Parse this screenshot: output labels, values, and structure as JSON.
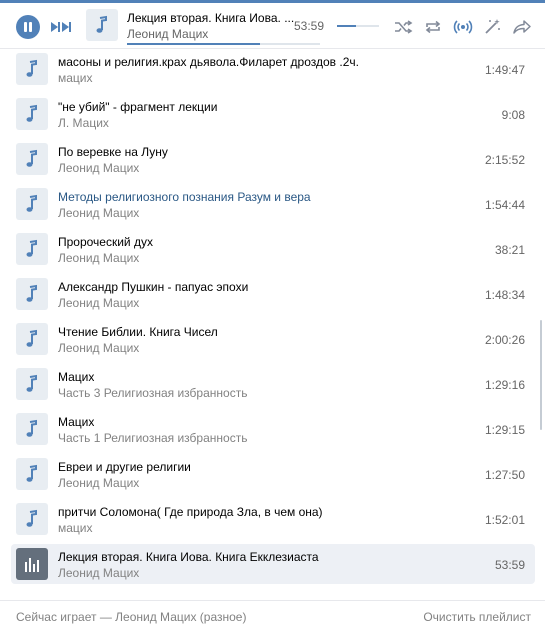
{
  "player": {
    "title": "Лекция вторая. Книга Иова. ...",
    "artist": "Леонид Мацих",
    "time": "53:59",
    "progress": 0.69,
    "volume": 0.45,
    "icons": [
      "pause-icon",
      "next-icon",
      "music-note-icon",
      "shuffle-icon",
      "repeat-icon",
      "broadcast-icon",
      "recommendations-icon",
      "share-icon"
    ]
  },
  "tracks": [
    {
      "title": "масоны и религия.крах дьявола.Филарет дроздов .2ч.",
      "artist": "мацих",
      "duration": "1:49:47"
    },
    {
      "title": "\"не убий\" - фрагмент лекции",
      "artist": "Л. Мацих",
      "duration": "9:08"
    },
    {
      "title": "По веревке на Луну",
      "artist": "Леонид Мацих",
      "duration": "2:15:52"
    },
    {
      "title": "Методы религиозного познания Разум и вера",
      "artist": "Леонид Мацих",
      "duration": "1:54:44"
    },
    {
      "title": "Пророческий дух",
      "artist": "Леонид Мацих",
      "duration": "38:21"
    },
    {
      "title": "Александр Пушкин - папуас эпохи",
      "artist": "Леонид Мацих",
      "duration": "1:48:34"
    },
    {
      "title": "Чтение Библии. Книга Чисел",
      "artist": "Леонид Мацих",
      "duration": "2:00:26"
    },
    {
      "title": "Мацих",
      "artist": "Часть 3 Религиозная избранность",
      "duration": "1:29:16"
    },
    {
      "title": "Мацих",
      "artist": "Часть 1 Религиозная избранность",
      "duration": "1:29:15"
    },
    {
      "title": "Евреи и другие религии",
      "artist": "Леонид Мацих",
      "duration": "1:27:50"
    },
    {
      "title": "притчи Соломона( Где природа Зла, в чем она)",
      "artist": "мацих",
      "duration": "1:52:01"
    },
    {
      "title": "Лекция вторая. Книга Иова. Книга Екклезиаста",
      "artist": "Леонид Мацих",
      "duration": "53:59"
    }
  ],
  "footer": {
    "now_playing": "Сейчас играет — Леонид Мацих (разное)",
    "clear_playlist": "Очистить плейлист"
  },
  "colors": {
    "accent": "#5181b8",
    "link": "#2a5885",
    "active_row": "#edf0f5",
    "muted_text": "#828282"
  }
}
